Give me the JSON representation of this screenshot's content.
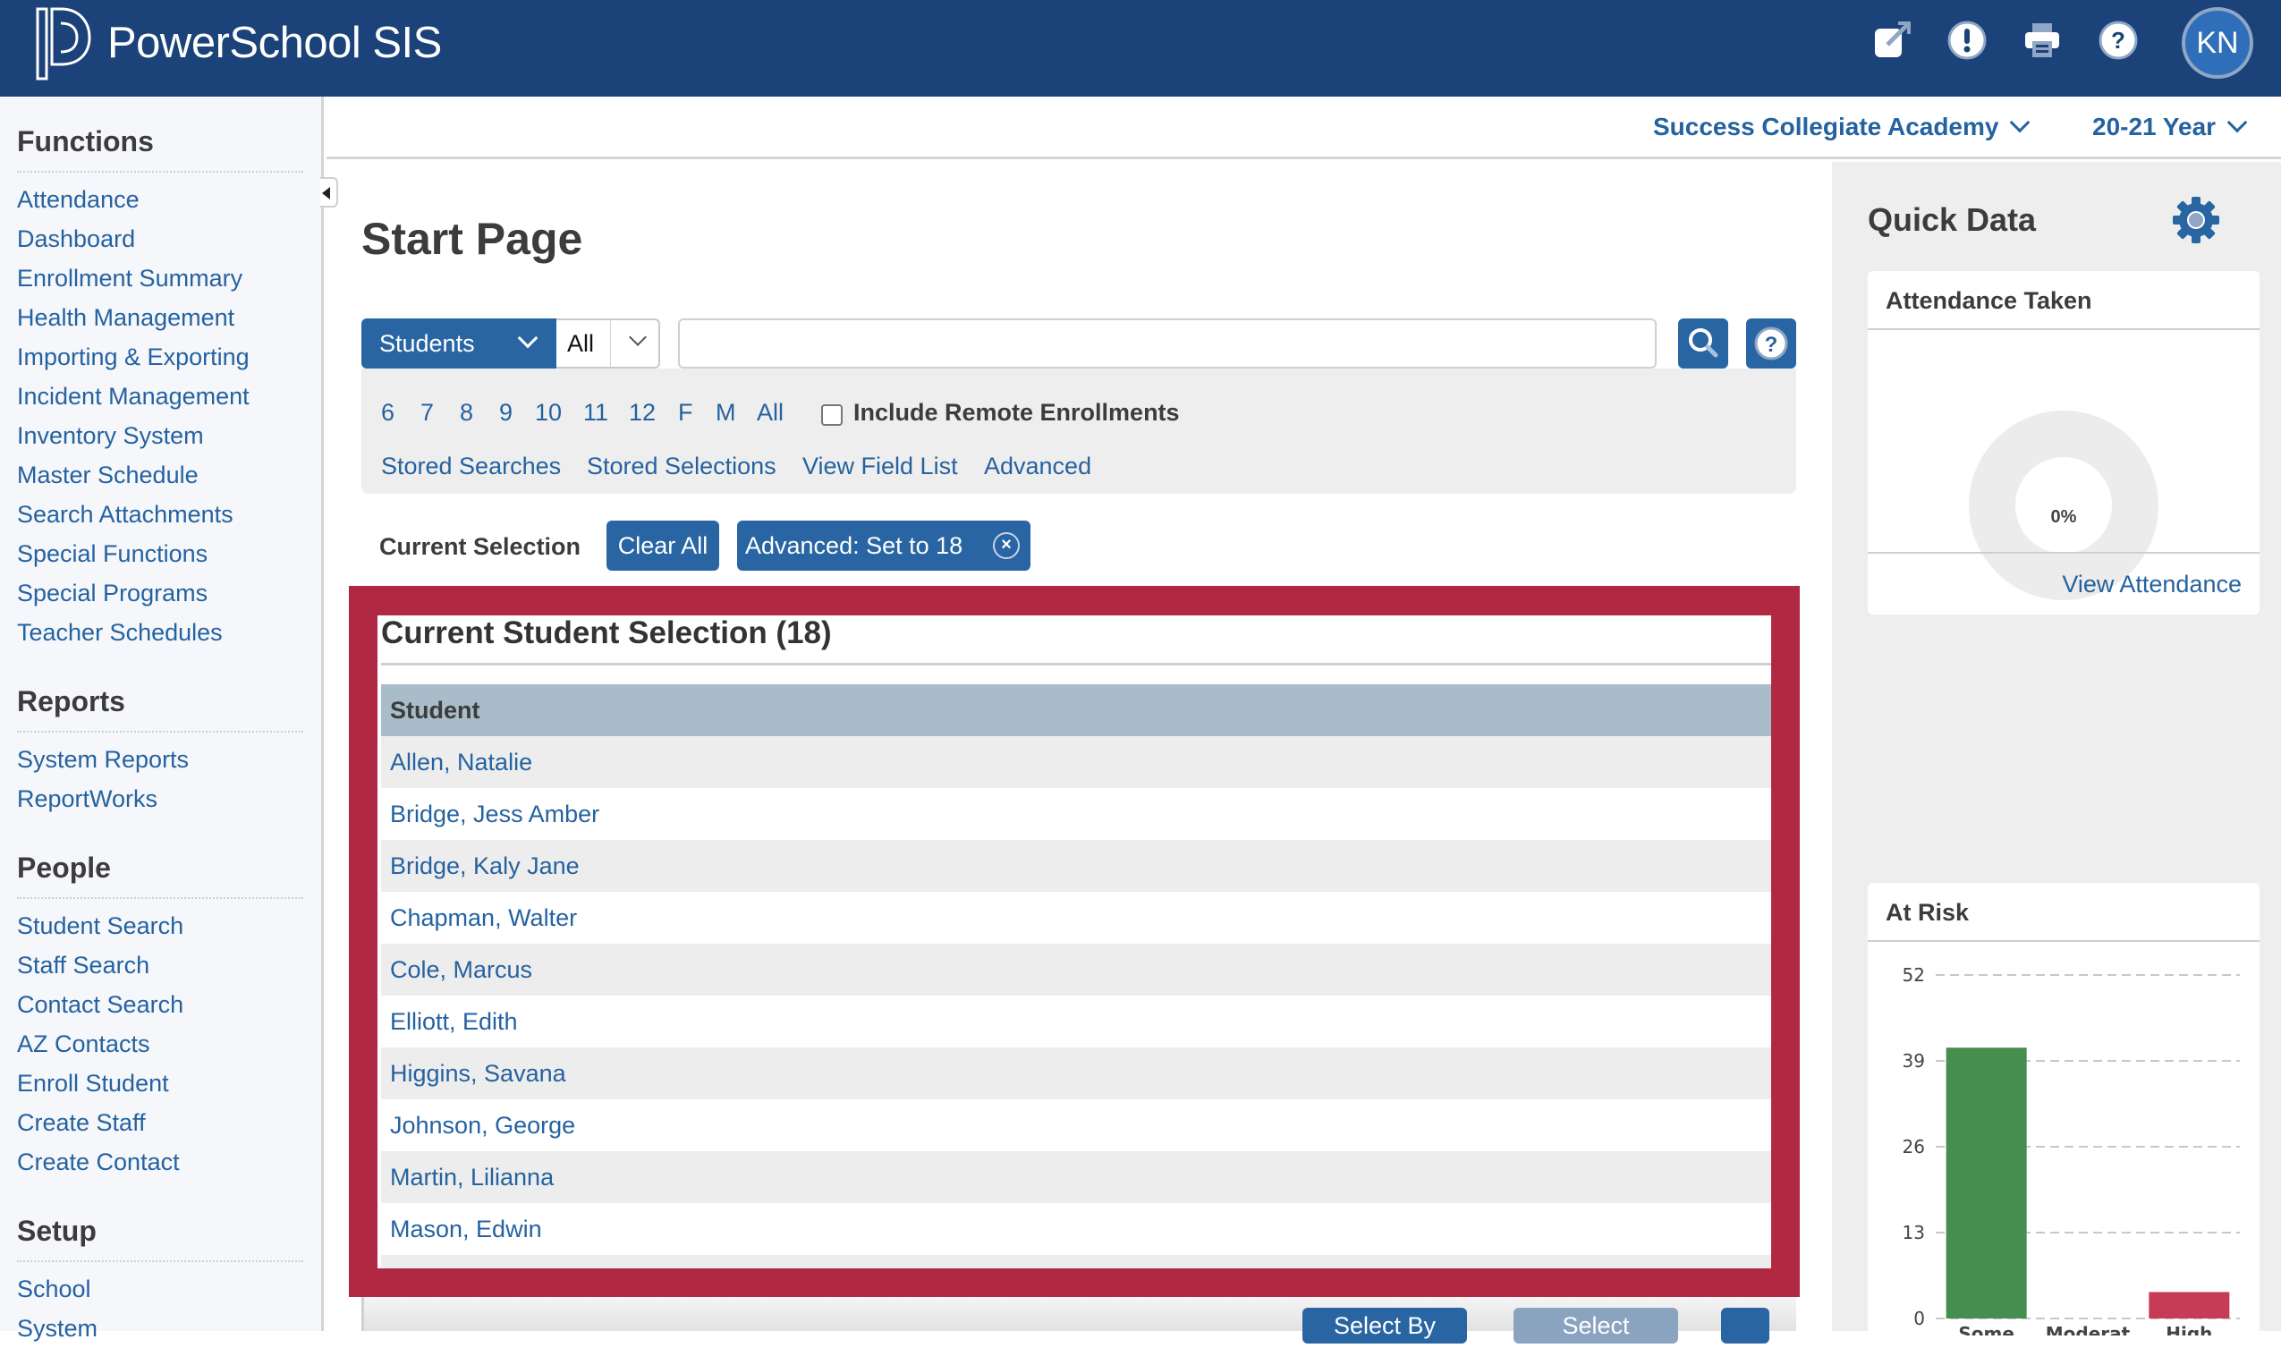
{
  "header": {
    "brand": "PowerSchool SIS",
    "icons": [
      "external-link-icon",
      "alert-icon",
      "print-icon",
      "help-icon"
    ],
    "avatar_initials": "KN"
  },
  "topnav": {
    "school": "Success Collegiate Academy",
    "year": "20-21 Year"
  },
  "sidebar": {
    "sections": [
      {
        "title": "Functions",
        "items": [
          "Attendance",
          "Dashboard",
          "Enrollment Summary",
          "Health Management",
          "Importing & Exporting",
          "Incident Management",
          "Inventory System",
          "Master Schedule",
          "Search Attachments",
          "Special Functions",
          "Special Programs",
          "Teacher Schedules"
        ]
      },
      {
        "title": "Reports",
        "items": [
          "System Reports",
          "ReportWorks"
        ]
      },
      {
        "title": "People",
        "items": [
          "Student Search",
          "Staff Search",
          "Contact Search",
          "AZ Contacts",
          "Enroll Student",
          "Create Staff",
          "Create Contact"
        ]
      },
      {
        "title": "Setup",
        "items": [
          "School",
          "System"
        ]
      }
    ]
  },
  "main": {
    "page_title": "Start Page",
    "search": {
      "type_selected": "Students",
      "scope_selected": "All",
      "query_value": "",
      "query_placeholder": ""
    },
    "grade_filters": [
      "6",
      "7",
      "8",
      "9",
      "10",
      "11",
      "12",
      "F",
      "M",
      "All"
    ],
    "include_remote_label": "Include Remote Enrollments",
    "include_remote_checked": false,
    "sub_links": [
      "Stored Searches",
      "Stored Selections",
      "View Field List",
      "Advanced"
    ],
    "current_selection_label": "Current Selection",
    "clear_all_label": "Clear All",
    "selection_chip": "Advanced: Set to 18",
    "selection_panel": {
      "title": "Current Student Selection (18)",
      "column_header": "Student",
      "students": [
        "Allen, Natalie",
        "Bridge, Jess Amber",
        "Bridge, Kaly Jane",
        "Chapman, Walter",
        "Cole, Marcus",
        "Elliott, Edith",
        "Higgins, Savana",
        "Johnson, George",
        "Martin, Lilianna",
        "Mason, Edwin"
      ]
    },
    "bottom_buttons": [
      "Select By Hand",
      "Select Function"
    ],
    "highlight_color": "#b12843"
  },
  "quick_data": {
    "title": "Quick Data",
    "attendance": {
      "title": "Attendance Taken",
      "percent_label": "0%",
      "percent_value": 0,
      "link": "View Attendance"
    },
    "at_risk": {
      "title": "At Risk"
    }
  },
  "chart_data": {
    "type": "bar",
    "title": "At Risk",
    "categories": [
      "Some",
      "Moderat",
      "High"
    ],
    "values": [
      41,
      0,
      4
    ],
    "colors": [
      "#458e4f",
      "#6c757d",
      "#c63b55"
    ],
    "yticks": [
      0,
      13,
      26,
      39,
      52
    ],
    "ylim": [
      0,
      52
    ],
    "grid": true,
    "xlabel": "",
    "ylabel": ""
  }
}
